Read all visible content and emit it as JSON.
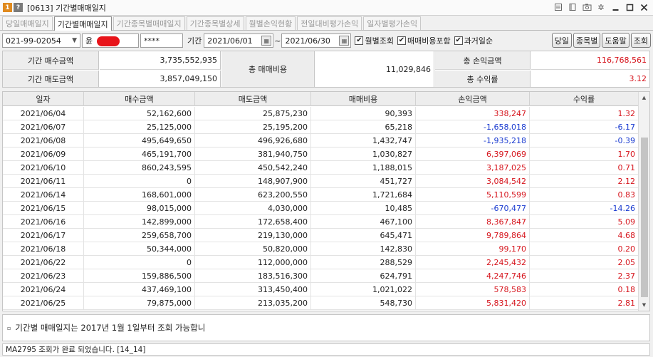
{
  "window": {
    "badge_number": "1",
    "badge_help": "?",
    "title": "[0613] 기간별매매일지",
    "icons": [
      "notepad-icon",
      "pin-icon",
      "camera-icon",
      "gear-icon",
      "minimize-icon",
      "maximize-icon",
      "close-icon"
    ]
  },
  "tabs": [
    {
      "label": "당일매매일지",
      "active": false
    },
    {
      "label": "기간별매매일지",
      "active": true
    },
    {
      "label": "기간종목별매매일지",
      "active": false
    },
    {
      "label": "기간종목별상세",
      "active": false
    },
    {
      "label": "월별손익현황",
      "active": false
    },
    {
      "label": "전일대비평가손익",
      "active": false
    },
    {
      "label": "일자별평가손익",
      "active": false
    }
  ],
  "search": {
    "account": "021-99-02054",
    "name_prefix": "윤",
    "password_mask": "****",
    "period_label": "기간",
    "date_from": "2021/06/01",
    "date_to": "2021/06/30",
    "separator": "~",
    "checkboxes": [
      {
        "label": "월별조회",
        "checked": true
      },
      {
        "label": "매매비용포함",
        "checked": true
      },
      {
        "label": "과거일순",
        "checked": true
      }
    ],
    "buttons": [
      "당일",
      "종목별",
      "도움말",
      "조회"
    ]
  },
  "summary": {
    "buy_label": "기간 매수금액",
    "buy_value": "3,735,552,935",
    "sell_label": "기간 매도금액",
    "sell_value": "3,857,049,150",
    "cost_label": "총 매매비용",
    "cost_value": "11,029,846",
    "pnl_label": "총 손익금액",
    "pnl_value": "116,768,561",
    "rate_label": "총 수익률",
    "rate_value": "3.12"
  },
  "table": {
    "headers": [
      "일자",
      "매수금액",
      "매도금액",
      "매매비용",
      "손익금액",
      "수익률"
    ],
    "rows": [
      [
        "2021/06/04",
        "52,162,600",
        "25,875,230",
        "90,393",
        "338,247",
        "1.32"
      ],
      [
        "2021/06/07",
        "25,125,000",
        "25,195,200",
        "65,218",
        "-1,658,018",
        "-6.17"
      ],
      [
        "2021/06/08",
        "495,649,650",
        "496,926,680",
        "1,432,747",
        "-1,935,218",
        "-0.39"
      ],
      [
        "2021/06/09",
        "465,191,700",
        "381,940,750",
        "1,030,827",
        "6,397,069",
        "1.70"
      ],
      [
        "2021/06/10",
        "860,243,595",
        "450,542,240",
        "1,188,015",
        "3,187,025",
        "0.71"
      ],
      [
        "2021/06/11",
        "0",
        "148,907,900",
        "451,727",
        "3,084,542",
        "2.12"
      ],
      [
        "2021/06/14",
        "168,601,000",
        "623,200,550",
        "1,721,684",
        "5,110,599",
        "0.83"
      ],
      [
        "2021/06/15",
        "98,015,000",
        "4,030,000",
        "10,485",
        "-670,477",
        "-14.26"
      ],
      [
        "2021/06/16",
        "142,899,000",
        "172,658,400",
        "467,100",
        "8,367,847",
        "5.09"
      ],
      [
        "2021/06/17",
        "259,658,700",
        "219,130,000",
        "645,471",
        "9,789,864",
        "4.68"
      ],
      [
        "2021/06/18",
        "50,344,000",
        "50,820,000",
        "142,830",
        "99,170",
        "0.20"
      ],
      [
        "2021/06/22",
        "0",
        "112,000,000",
        "288,529",
        "2,245,432",
        "2.05"
      ],
      [
        "2021/06/23",
        "159,886,500",
        "183,516,300",
        "624,791",
        "4,247,746",
        "2.37"
      ],
      [
        "2021/06/24",
        "437,469,100",
        "313,450,400",
        "1,021,022",
        "578,583",
        "0.18"
      ],
      [
        "2021/06/25",
        "79,875,000",
        "213,035,200",
        "548,730",
        "5,831,420",
        "2.81"
      ]
    ]
  },
  "notice": "기간별 매매일지는 2017년 1월 1일부터 조회 가능합니",
  "status": "MA2795 조회가 완료 되었습니다. [14_14]",
  "colors": {
    "positive": "#d6141c",
    "negative": "#1a3bd0",
    "accent": "#e08a1e"
  }
}
